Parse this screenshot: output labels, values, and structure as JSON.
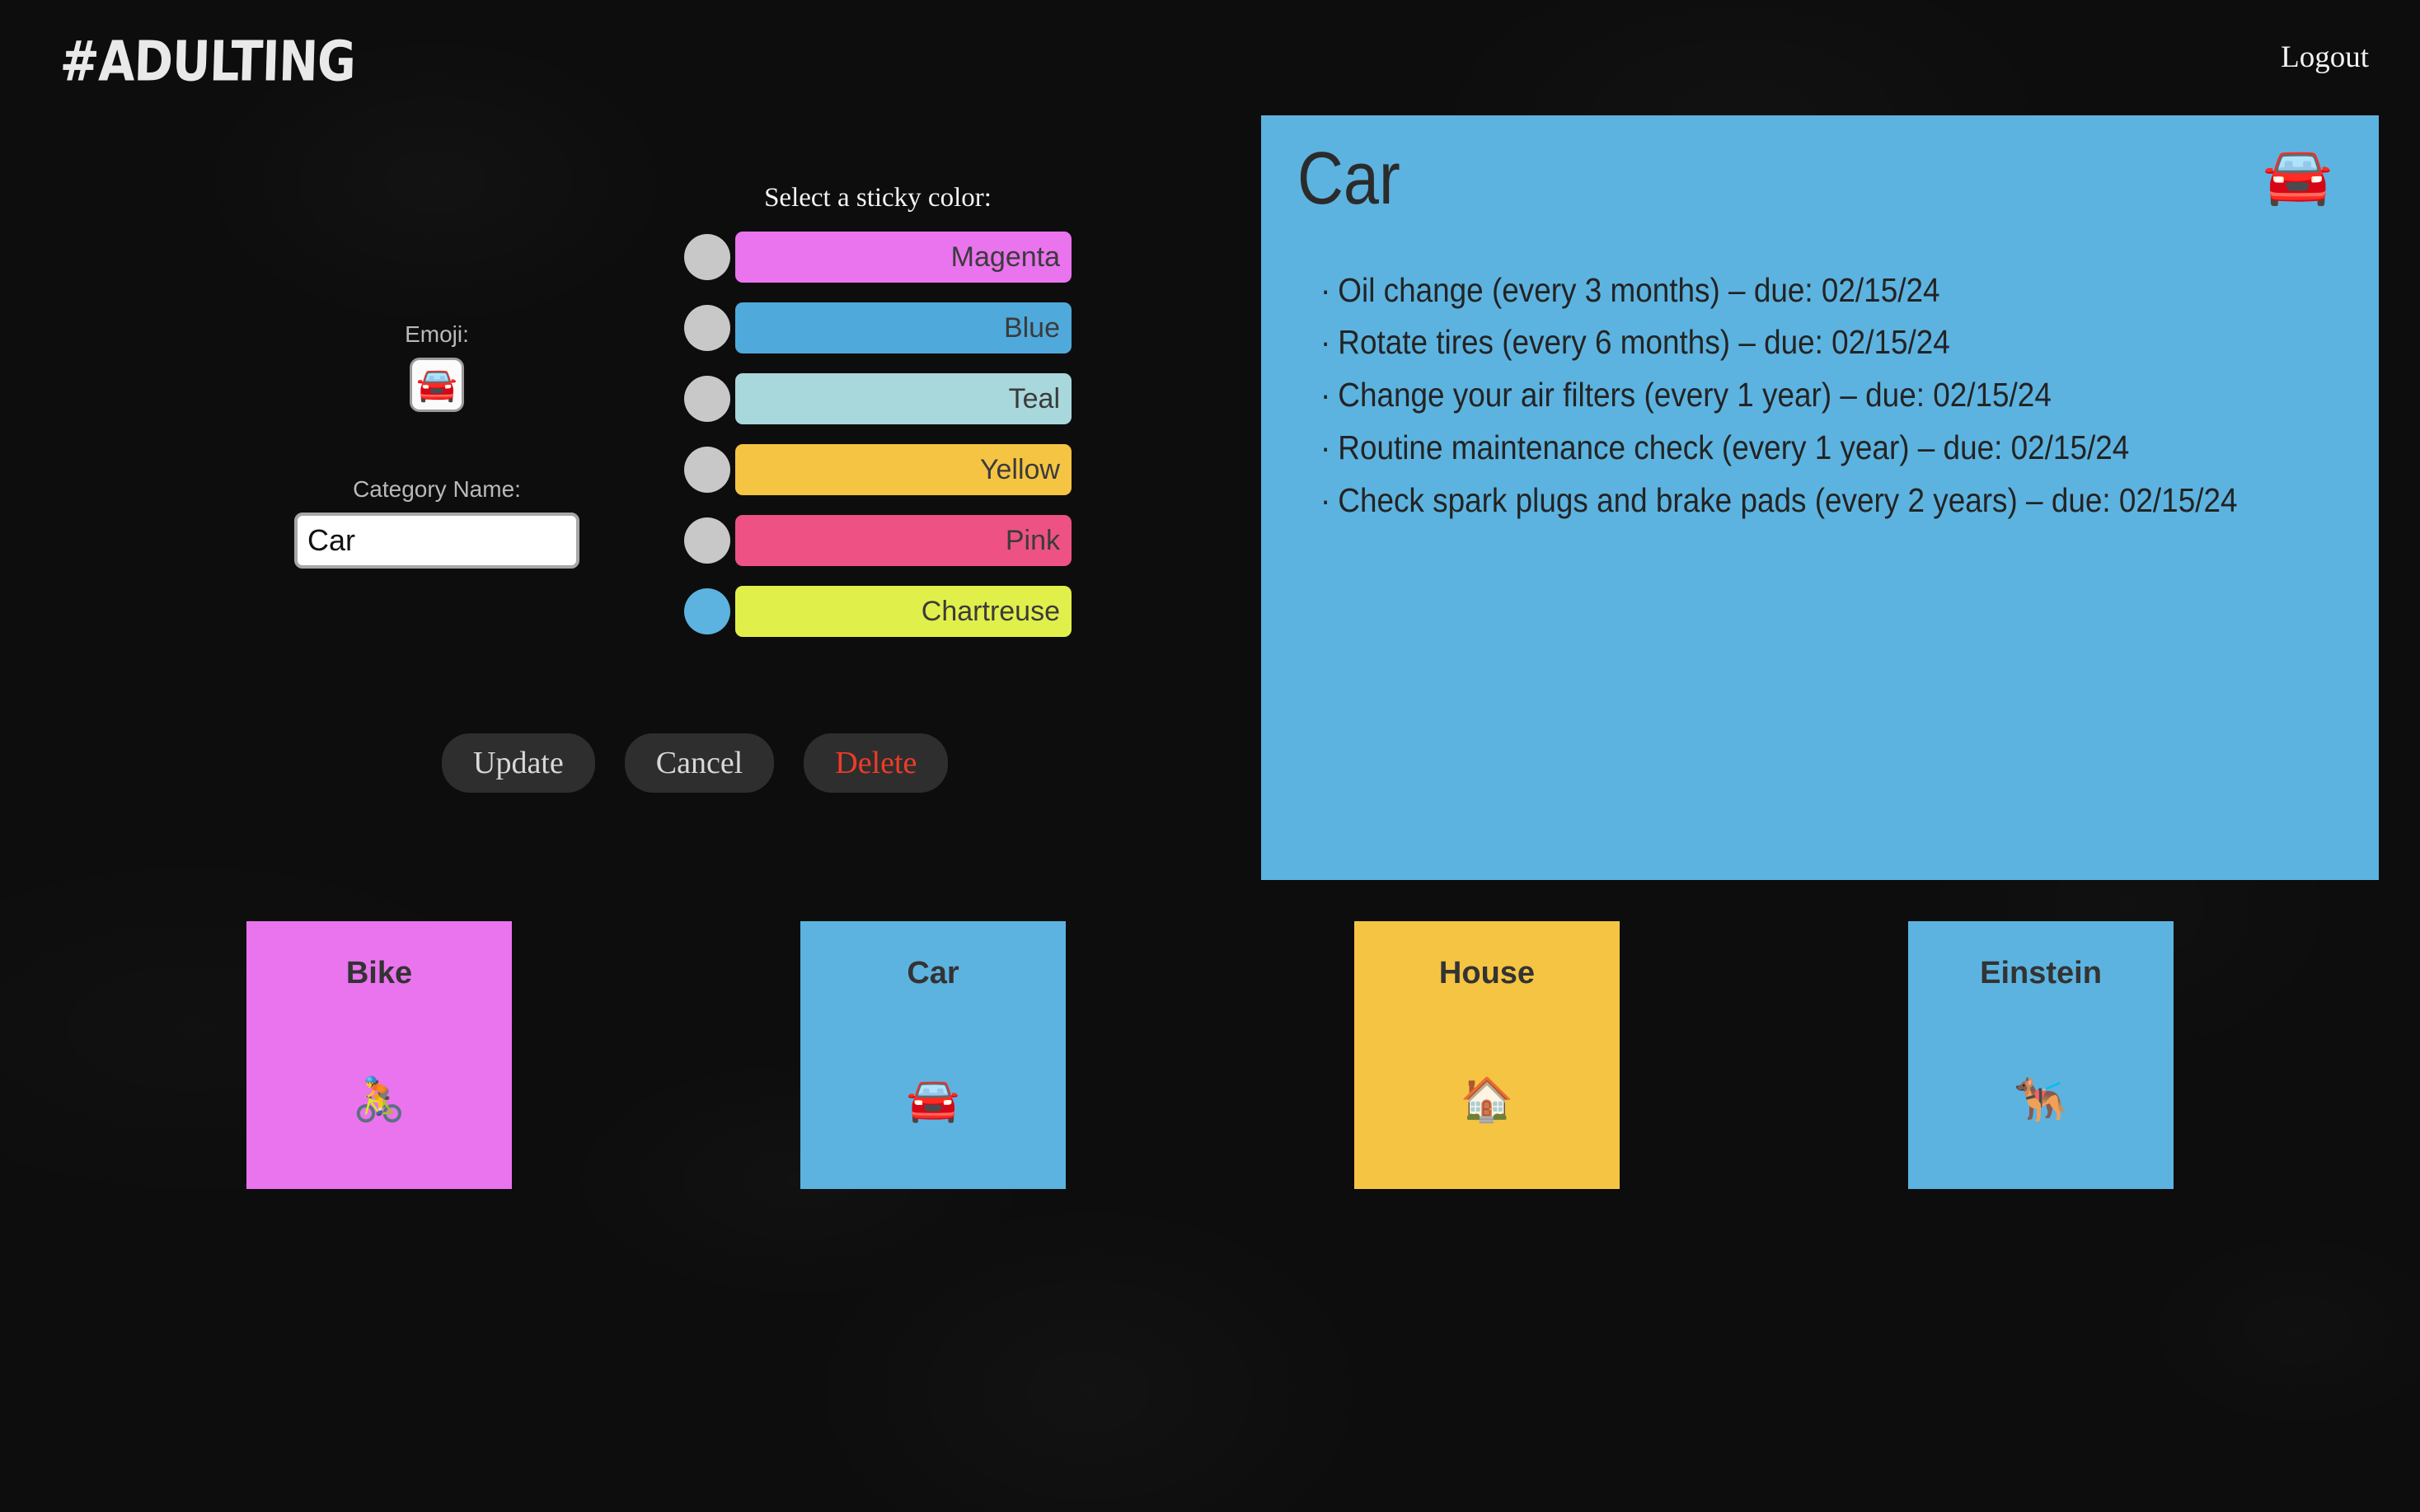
{
  "header": {
    "brand": "#ADULTING",
    "logout_label": "Logout"
  },
  "edit_form": {
    "emoji_label": "Emoji:",
    "emoji_value": "🚘",
    "name_label": "Category Name:",
    "name_value": "Car",
    "name_placeholder": "Category Name",
    "actions": {
      "update_label": "Update",
      "cancel_label": "Cancel",
      "delete_label": "Delete"
    }
  },
  "color_picker": {
    "heading": "Select a sticky color:",
    "selected": "Chartreuse",
    "options": [
      {
        "label": "Magenta",
        "hex": "#EA73EE",
        "selected": false
      },
      {
        "label": "Blue",
        "hex": "#4FAADB",
        "selected": false
      },
      {
        "label": "Teal",
        "hex": "#A8D7DC",
        "selected": false
      },
      {
        "label": "Yellow",
        "hex": "#F5C443",
        "selected": false
      },
      {
        "label": "Pink",
        "hex": "#EE5285",
        "selected": false
      },
      {
        "label": "Chartreuse",
        "hex": "#E1EF4B",
        "selected": true
      }
    ],
    "radio_unselected_hex": "#C8C8C8",
    "radio_selected_hex": "#5CB3E0"
  },
  "sticky_note": {
    "title": "Car",
    "emoji": "🚘",
    "background_hex": "#5CB3E0",
    "tasks": [
      "Oil change   (every 3 months)  –  due: 02/15/24",
      "Rotate tires   (every 6 months)  –  due: 02/15/24",
      "Change your air filters   (every 1 year)  –  due: 02/15/24",
      "Routine maintenance check   (every 1 year)  –  due: 02/15/24",
      "Check spark plugs and brake pads   (every 2 years)  –   due: 02/15/24"
    ]
  },
  "categories": [
    {
      "title": "Bike",
      "emoji": "🚴",
      "hex": "#EA73EE"
    },
    {
      "title": "Car",
      "emoji": "🚘",
      "hex": "#5CB3E0"
    },
    {
      "title": "House",
      "emoji": "🏠",
      "hex": "#F5C443"
    },
    {
      "title": "Einstein",
      "emoji": "🐕‍🦺",
      "hex": "#5CB3E0"
    }
  ]
}
